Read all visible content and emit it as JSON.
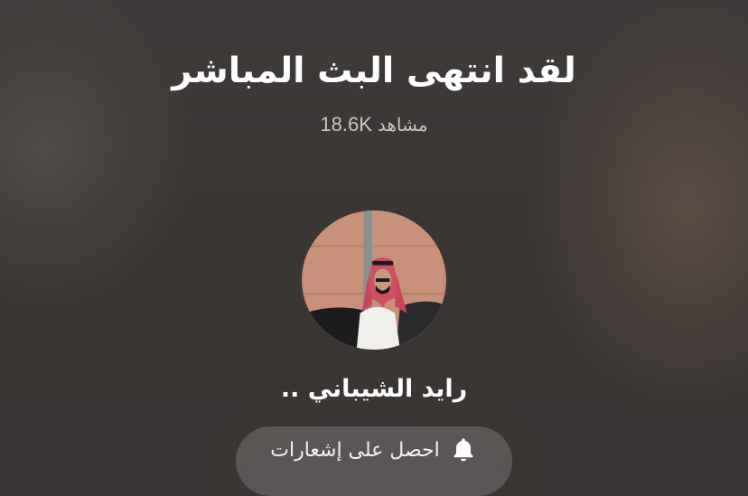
{
  "live_ended": {
    "title": "لقد انتهى البث المباشر",
    "viewers_count": "18.6K",
    "viewers_label": "مشاهد"
  },
  "host": {
    "name": "رايد الشيباني .."
  },
  "notify_button": {
    "label": "احصل على إشعارات",
    "icon": "bell-icon"
  },
  "colors": {
    "background": "#3c3837",
    "button_bg": "rgba(255,255,255,0.16)",
    "text": "#ffffff",
    "muted_text": "#c9c5c3"
  }
}
